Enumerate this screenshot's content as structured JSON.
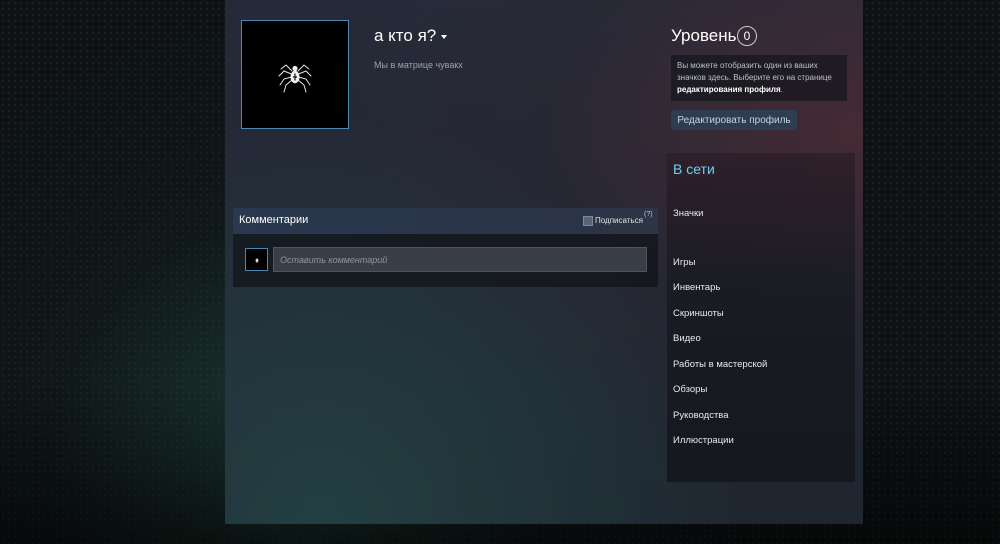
{
  "profile": {
    "name": "а кто я?",
    "summary": "Мы в матрице чувакх",
    "avatar_icon": "spider-icon"
  },
  "level": {
    "title": "Уровень",
    "value": "0"
  },
  "badge_hint": {
    "text_before": "Вы можете отобразить один из ваших значков здесь. Выберите его на странице ",
    "link": "редактирования профиля",
    "text_after": "."
  },
  "edit_profile_label": "Редактировать профиль",
  "sidebar": {
    "status": "В сети",
    "badges_label": "Значки",
    "links": [
      "Игры",
      "Инвентарь",
      "Скриншоты",
      "Видео",
      "Работы в мастерской",
      "Обзоры",
      "Руководства",
      "Иллюстрации"
    ]
  },
  "comments": {
    "title": "Комментарии",
    "subscribe_label": "Подписаться",
    "help_label": "(?)",
    "input_placeholder": "Оставить комментарий"
  },
  "colors": {
    "online_accent": "#6dcff6",
    "avatar_border": "#4f87b3"
  }
}
